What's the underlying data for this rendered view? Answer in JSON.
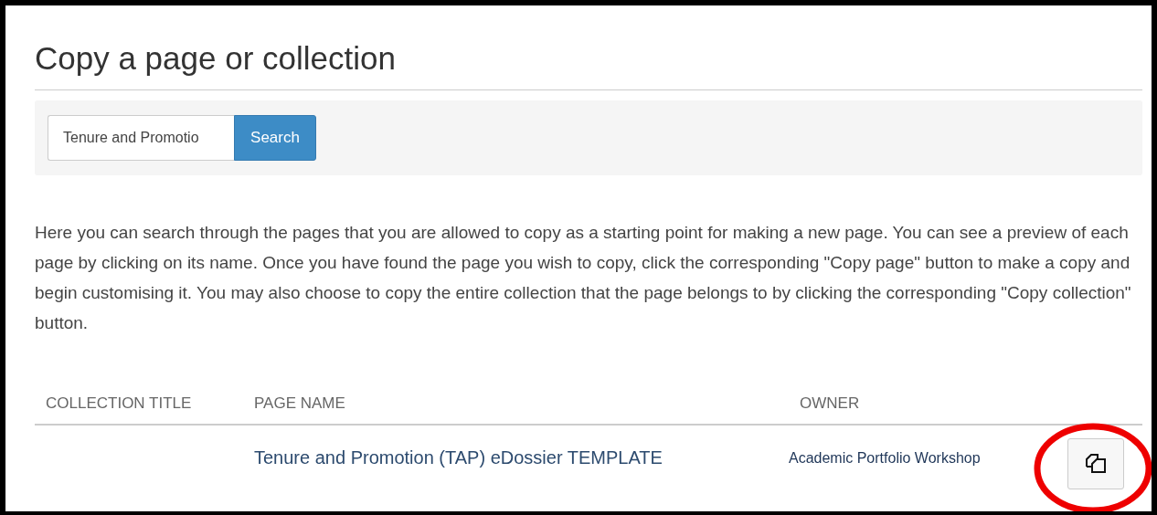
{
  "title": "Copy a page or collection",
  "search": {
    "value": "Tenure and Promotio",
    "button": "Search"
  },
  "description": "Here you can search through the pages that you are allowed to copy as a starting point for making a new page. You can see a preview of each page by clicking on its name. Once you have found the page you wish to copy, click the corresponding \"Copy page\" button to make a copy and begin customising it. You may also choose to copy the entire collection that the page belongs to by clicking the corresponding \"Copy collection\" button.",
  "table": {
    "columns": [
      "COLLECTION TITLE",
      "PAGE NAME",
      "OWNER"
    ],
    "rows": [
      {
        "page_name": "Tenure and Promotion (TAP) eDossier TEMPLATE",
        "owner": "Academic Portfolio Workshop"
      }
    ]
  }
}
